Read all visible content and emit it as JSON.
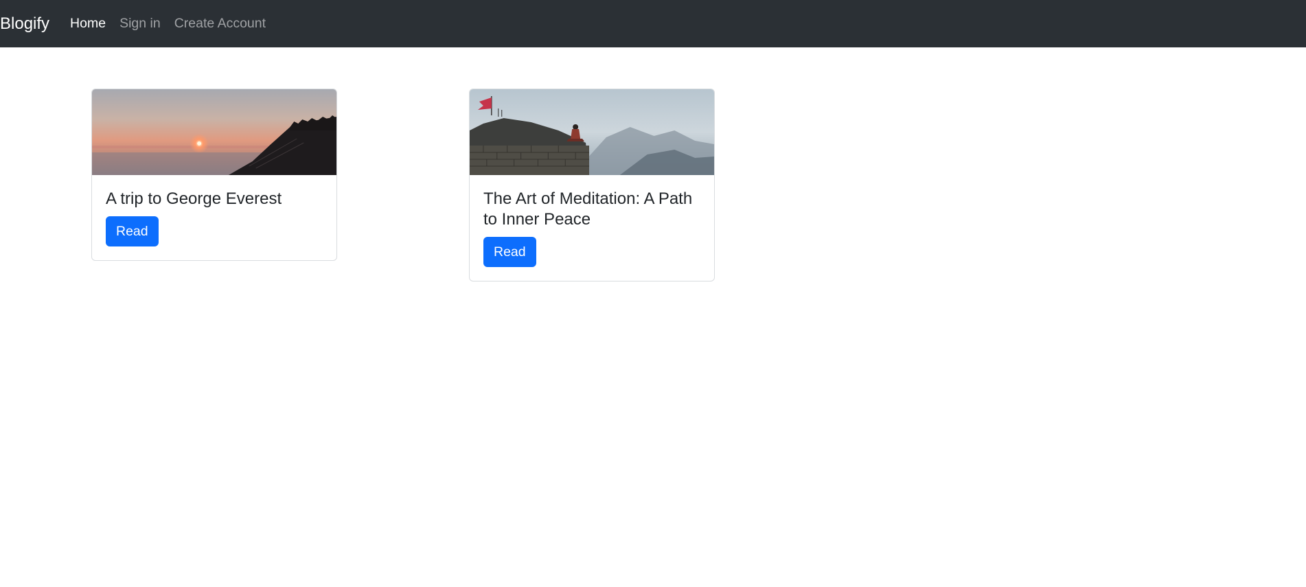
{
  "navbar": {
    "brand": "Blogify",
    "links": [
      {
        "label": "Home",
        "active": true
      },
      {
        "label": "Sign in",
        "active": false
      },
      {
        "label": "Create Account",
        "active": false
      }
    ]
  },
  "posts": [
    {
      "title": "A trip to George Everest",
      "button_label": "Read",
      "image": "sunset-mountain-image"
    },
    {
      "title": "The Art of Meditation: A Path to Inner Peace",
      "button_label": "Read",
      "image": "meditation-mountain-image"
    }
  ],
  "colors": {
    "navbar_bg": "#2b3035",
    "primary": "#0d6efd"
  }
}
